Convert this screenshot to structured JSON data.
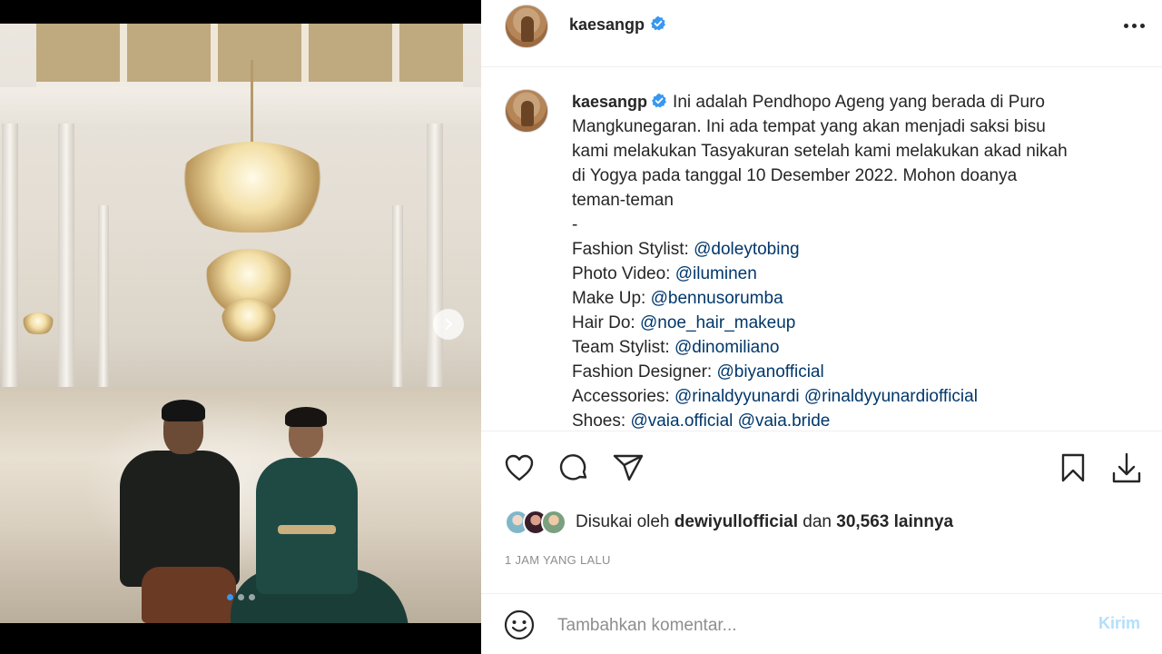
{
  "post": {
    "username": "kaesangp",
    "verified": true,
    "caption_lines": [
      "Ini adalah Pendhopo Ageng yang berada di Puro",
      "Mangkunegaran. Ini ada tempat yang akan menjadi saksi bisu",
      "kami melakukan Tasyakuran setelah kami melakukan akad nikah",
      "di Yogya pada tanggal 10 Desember 2022. Mohon doanya",
      "teman-teman",
      "-"
    ],
    "credits": [
      {
        "label": "Fashion Stylist:",
        "mentions": [
          "@doleytobing"
        ]
      },
      {
        "label": "Photo Video:",
        "mentions": [
          "@iluminen"
        ]
      },
      {
        "label": "Make Up:",
        "mentions": [
          "@bennusorumba"
        ]
      },
      {
        "label": "Hair Do:",
        "mentions": [
          "@noe_hair_makeup"
        ]
      },
      {
        "label": "Team Stylist:",
        "mentions": [
          "@dinomiliano"
        ]
      },
      {
        "label": "Fashion Designer:",
        "mentions": [
          "@biyanofficial"
        ]
      },
      {
        "label": "Accessories:",
        "mentions": [
          "@rinaldyyunardi",
          "@rinaldyyunardiofficial"
        ]
      },
      {
        "label": "Shoes:",
        "mentions": [
          "@vaia.official",
          "@vaia.bride"
        ]
      }
    ],
    "likes": {
      "prefix": "Disukai oleh",
      "user": "dewiyullofficial",
      "middle": "dan",
      "count": "30,563",
      "suffix": "lainnya"
    },
    "timestamp": "1 JAM YANG LALU",
    "carousel": {
      "total": 3,
      "active": 1
    }
  },
  "comment": {
    "placeholder": "Tambahkan komentar...",
    "post_label": "Kirim"
  },
  "icons": {
    "like": "heart-icon",
    "comment": "comment-icon",
    "share": "paper-plane-icon",
    "save": "bookmark-icon",
    "download": "download-icon",
    "emoji": "emoji-icon",
    "more": "more-options-icon",
    "next": "chevron-right-icon",
    "verified": "verified-badge-icon"
  },
  "colors": {
    "verified": "#3897f0",
    "mention": "#00376b",
    "muted": "#8e8e8e",
    "post_button": "#b2dffc"
  }
}
